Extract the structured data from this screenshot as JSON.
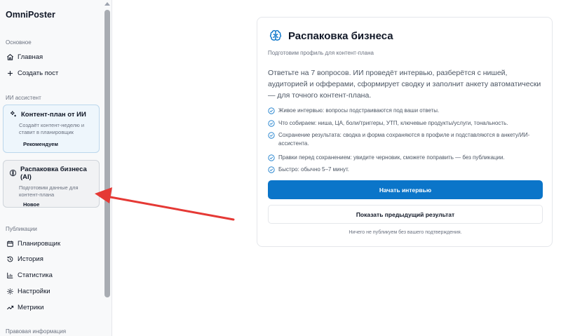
{
  "brand": "OmniPoster",
  "sidebar": {
    "sections": {
      "main": "Основное",
      "assistant": "ИИ ассистент",
      "publications": "Публикации",
      "legal": "Правовая информация"
    },
    "main_items": [
      {
        "label": "Главная",
        "icon": "home-icon"
      },
      {
        "label": "Создать пост",
        "icon": "plus-icon"
      }
    ],
    "assistant_cards": [
      {
        "title": "Контент-план от ИИ",
        "description": "Создаёт контент-неделю и ставит в планировщик",
        "badge": "Рекомендуем",
        "icon": "sparkle-icon"
      },
      {
        "title": "Распаковка бизнеса (AI)",
        "description": "Подготовим данные для контент-плана",
        "badge": "Новое",
        "icon": "brain-icon"
      }
    ],
    "publication_items": [
      {
        "label": "Планировщик",
        "icon": "calendar-icon"
      },
      {
        "label": "История",
        "icon": "history-icon"
      },
      {
        "label": "Статистика",
        "icon": "bar-chart-icon"
      },
      {
        "label": "Настройки",
        "icon": "gear-icon"
      },
      {
        "label": "Метрики",
        "icon": "trend-icon"
      }
    ]
  },
  "panel": {
    "title": "Распаковка бизнеса",
    "subtitle": "Подготовим профиль для контент-плана",
    "intro": "Ответьте на 7 вопросов. ИИ проведёт интервью, разберётся с нишей, аудиторией и офферами, сформирует сводку и заполнит анкету автоматически — для точного контент-плана.",
    "features": [
      "Живое интервью: вопросы подстраиваются под ваши ответы.",
      "Что собираем: ниша, ЦА, боли/триггеры, УТП, ключевые продукты/услуги, тональность.",
      "Сохранение результата: сводка и форма сохраняются в профиле и подставляются в анкету/ИИ-ассистента.",
      "Правки перед сохранением: увидите черновик, сможете поправить — без публикации.",
      "Быстро: обычно 5–7 минут."
    ],
    "primary_button": "Начать интервью",
    "secondary_button": "Показать предыдущий результат",
    "footnote": "Ничего не публикуем без вашего подтверждения."
  },
  "colors": {
    "accent": "#0b75c9",
    "annotation_arrow": "#e53935"
  }
}
